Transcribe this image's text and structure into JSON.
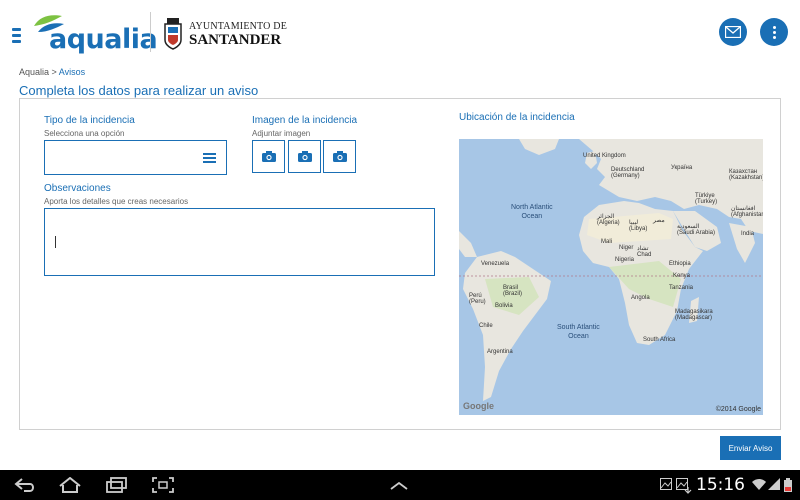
{
  "header": {
    "brand": "aqualia",
    "partner_line1": "AYUNTAMIENTO DE",
    "partner_line2": "SANTANDER",
    "icons": [
      "menu-icon",
      "mail-icon",
      "more-vert-icon"
    ],
    "accent": "#1a6fb5"
  },
  "breadcrumb": {
    "root": "Aqualia",
    "separator": " > ",
    "current": "Avisos"
  },
  "page_title": "Completa los datos para realizar un aviso",
  "form": {
    "tipo_label": "Tipo de la incidencia",
    "tipo_hint": "Selecciona una opción",
    "tipo_value": "",
    "imagen_label": "Imagen de la incidencia",
    "imagen_hint": "Adjuntar imagen",
    "observaciones_label": "Observaciones",
    "observaciones_hint": "Aporta los detalles que creas necesarios",
    "observaciones_value": "",
    "ubicacion_label": "Ubicación de la incidencia",
    "send_label": "Enviar Aviso"
  },
  "map": {
    "oceans": [
      "North Atlantic\nOcean",
      "South Atlantic\nOcean"
    ],
    "labels": [
      "United Kingdom",
      "Deutschland\n(Germany)",
      "Україна",
      "Казахстан\n(Kazakhstan)",
      "Türkiye\n(Turkey)",
      "افغانستان\n(Afghanistan)",
      "الجزائر\n(Algeria)",
      "ليبيا\n(Libya)",
      "مصر",
      "السعودية\n(Saudi Arabia)",
      "India",
      "Mali",
      "Niger",
      "تشاد\nChad",
      "Nigeria",
      "Ethiopia",
      "Venezuela",
      "Kenya",
      "Tanzania",
      "Brasil\n(Brazil)",
      "Perú\n(Peru)",
      "Bolivia",
      "Angola",
      "Madagasikara\n(Madagascar)",
      "Chile",
      "South Africa",
      "Argentina"
    ],
    "watermark": "Google",
    "copyright": "©2014 Google"
  },
  "system_bar": {
    "time": "15:16",
    "icons": [
      "back-icon",
      "home-icon",
      "recent-apps-icon",
      "screenshot-icon",
      "up-chevron-icon",
      "gallery-icon",
      "gallery-icon",
      "download-icon",
      "wifi-icon",
      "signal-icon",
      "battery-icon"
    ]
  }
}
